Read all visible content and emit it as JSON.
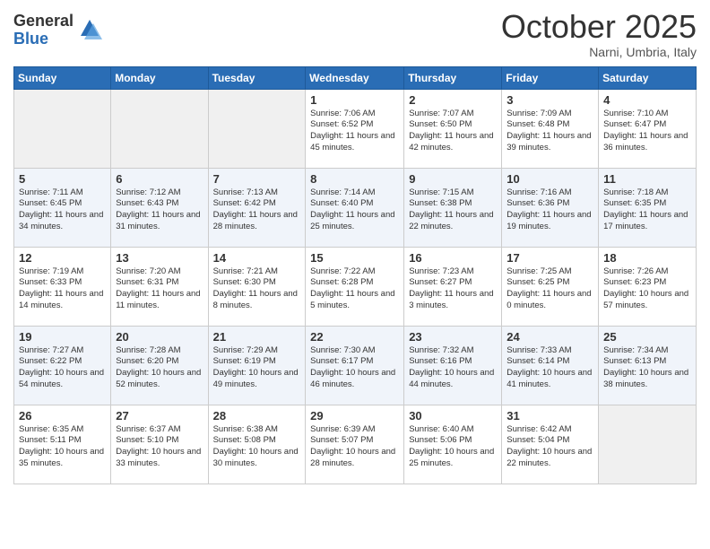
{
  "logo": {
    "general": "General",
    "blue": "Blue"
  },
  "header": {
    "month": "October 2025",
    "location": "Narni, Umbria, Italy"
  },
  "days_of_week": [
    "Sunday",
    "Monday",
    "Tuesday",
    "Wednesday",
    "Thursday",
    "Friday",
    "Saturday"
  ],
  "weeks": [
    [
      {
        "day": "",
        "info": ""
      },
      {
        "day": "",
        "info": ""
      },
      {
        "day": "",
        "info": ""
      },
      {
        "day": "1",
        "info": "Sunrise: 7:06 AM\nSunset: 6:52 PM\nDaylight: 11 hours and 45 minutes."
      },
      {
        "day": "2",
        "info": "Sunrise: 7:07 AM\nSunset: 6:50 PM\nDaylight: 11 hours and 42 minutes."
      },
      {
        "day": "3",
        "info": "Sunrise: 7:09 AM\nSunset: 6:48 PM\nDaylight: 11 hours and 39 minutes."
      },
      {
        "day": "4",
        "info": "Sunrise: 7:10 AM\nSunset: 6:47 PM\nDaylight: 11 hours and 36 minutes."
      }
    ],
    [
      {
        "day": "5",
        "info": "Sunrise: 7:11 AM\nSunset: 6:45 PM\nDaylight: 11 hours and 34 minutes."
      },
      {
        "day": "6",
        "info": "Sunrise: 7:12 AM\nSunset: 6:43 PM\nDaylight: 11 hours and 31 minutes."
      },
      {
        "day": "7",
        "info": "Sunrise: 7:13 AM\nSunset: 6:42 PM\nDaylight: 11 hours and 28 minutes."
      },
      {
        "day": "8",
        "info": "Sunrise: 7:14 AM\nSunset: 6:40 PM\nDaylight: 11 hours and 25 minutes."
      },
      {
        "day": "9",
        "info": "Sunrise: 7:15 AM\nSunset: 6:38 PM\nDaylight: 11 hours and 22 minutes."
      },
      {
        "day": "10",
        "info": "Sunrise: 7:16 AM\nSunset: 6:36 PM\nDaylight: 11 hours and 19 minutes."
      },
      {
        "day": "11",
        "info": "Sunrise: 7:18 AM\nSunset: 6:35 PM\nDaylight: 11 hours and 17 minutes."
      }
    ],
    [
      {
        "day": "12",
        "info": "Sunrise: 7:19 AM\nSunset: 6:33 PM\nDaylight: 11 hours and 14 minutes."
      },
      {
        "day": "13",
        "info": "Sunrise: 7:20 AM\nSunset: 6:31 PM\nDaylight: 11 hours and 11 minutes."
      },
      {
        "day": "14",
        "info": "Sunrise: 7:21 AM\nSunset: 6:30 PM\nDaylight: 11 hours and 8 minutes."
      },
      {
        "day": "15",
        "info": "Sunrise: 7:22 AM\nSunset: 6:28 PM\nDaylight: 11 hours and 5 minutes."
      },
      {
        "day": "16",
        "info": "Sunrise: 7:23 AM\nSunset: 6:27 PM\nDaylight: 11 hours and 3 minutes."
      },
      {
        "day": "17",
        "info": "Sunrise: 7:25 AM\nSunset: 6:25 PM\nDaylight: 11 hours and 0 minutes."
      },
      {
        "day": "18",
        "info": "Sunrise: 7:26 AM\nSunset: 6:23 PM\nDaylight: 10 hours and 57 minutes."
      }
    ],
    [
      {
        "day": "19",
        "info": "Sunrise: 7:27 AM\nSunset: 6:22 PM\nDaylight: 10 hours and 54 minutes."
      },
      {
        "day": "20",
        "info": "Sunrise: 7:28 AM\nSunset: 6:20 PM\nDaylight: 10 hours and 52 minutes."
      },
      {
        "day": "21",
        "info": "Sunrise: 7:29 AM\nSunset: 6:19 PM\nDaylight: 10 hours and 49 minutes."
      },
      {
        "day": "22",
        "info": "Sunrise: 7:30 AM\nSunset: 6:17 PM\nDaylight: 10 hours and 46 minutes."
      },
      {
        "day": "23",
        "info": "Sunrise: 7:32 AM\nSunset: 6:16 PM\nDaylight: 10 hours and 44 minutes."
      },
      {
        "day": "24",
        "info": "Sunrise: 7:33 AM\nSunset: 6:14 PM\nDaylight: 10 hours and 41 minutes."
      },
      {
        "day": "25",
        "info": "Sunrise: 7:34 AM\nSunset: 6:13 PM\nDaylight: 10 hours and 38 minutes."
      }
    ],
    [
      {
        "day": "26",
        "info": "Sunrise: 6:35 AM\nSunset: 5:11 PM\nDaylight: 10 hours and 35 minutes."
      },
      {
        "day": "27",
        "info": "Sunrise: 6:37 AM\nSunset: 5:10 PM\nDaylight: 10 hours and 33 minutes."
      },
      {
        "day": "28",
        "info": "Sunrise: 6:38 AM\nSunset: 5:08 PM\nDaylight: 10 hours and 30 minutes."
      },
      {
        "day": "29",
        "info": "Sunrise: 6:39 AM\nSunset: 5:07 PM\nDaylight: 10 hours and 28 minutes."
      },
      {
        "day": "30",
        "info": "Sunrise: 6:40 AM\nSunset: 5:06 PM\nDaylight: 10 hours and 25 minutes."
      },
      {
        "day": "31",
        "info": "Sunrise: 6:42 AM\nSunset: 5:04 PM\nDaylight: 10 hours and 22 minutes."
      },
      {
        "day": "",
        "info": ""
      }
    ]
  ]
}
